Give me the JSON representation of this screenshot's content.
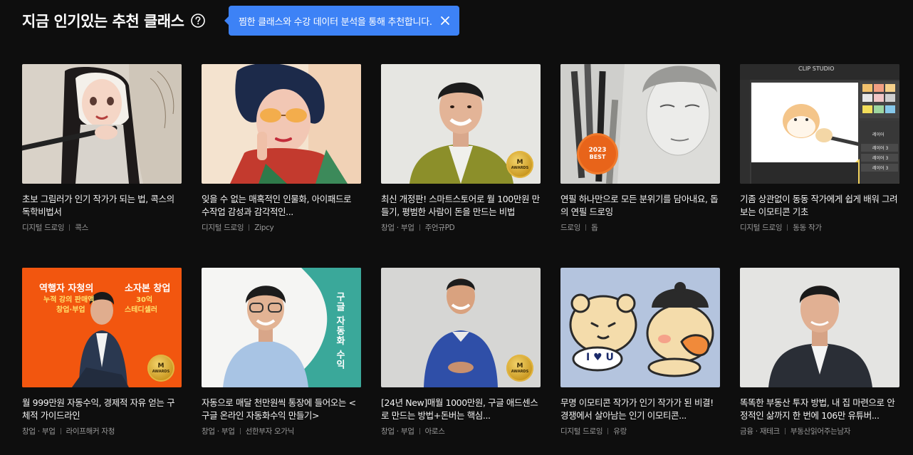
{
  "section": {
    "title": "지금 인기있는 추천 클래스"
  },
  "tooltip": {
    "text": "찜한 클래스와 수강 데이터 분석을 통해 추천합니다."
  },
  "icons": {
    "help": "question-circle-icon",
    "close": "close-icon"
  },
  "colors": {
    "background": "#0e0e0e",
    "tooltip": "#3d82f6",
    "meta": "#9a9a9a"
  },
  "cards": [
    {
      "title": "초보 그림러가 인기 작가가 되는 법, 콕스의 독학비법서",
      "category": "디지털 드로잉",
      "creator": "콕스"
    },
    {
      "title": "잊을 수 없는 매혹적인 인물화, 아이패드로 수작업 감성과 감각적인...",
      "category": "디지털 드로잉",
      "creator": "Zipcy"
    },
    {
      "title": "최신 개정판! 스마트스토어로 월 100만원 만들기, 평범한 사람이 돈을 만드는 비법",
      "category": "창업 · 부업",
      "creator": "주언규PD",
      "badge": "AWARDS"
    },
    {
      "title": "연필 하나만으로 모든 분위기를 담아내요, 돕의 연필 드로잉",
      "category": "드로잉",
      "creator": "돕",
      "badge_year": "2023",
      "badge_text": "BEST"
    },
    {
      "title": "기좀 상관없이 동동 작가에게 쉽게 배워 그려보는 이모티콘 기초",
      "category": "디지털 드로잉",
      "creator": "동동 작가",
      "app_label": "CLIP STUDIO",
      "layer_labels": [
        "레이어",
        "레이어 3",
        "레이어 3",
        "레이어 3"
      ]
    },
    {
      "title": "월 999만원 자동수익, 경제적 자유 얻는 구체적 가이드라인",
      "category": "창업 · 부업",
      "creator": "라이프해커 자청",
      "badge": "AWARDS",
      "overlay": {
        "left_title": "역행자 자청의",
        "right_title": "소자본 창업",
        "line2_left": "누적 강의 판매액",
        "line2_right": "30억",
        "line3_left": "창업·부업",
        "line3_right": "스테디셀러"
      }
    },
    {
      "title": "자동으로 매달 천만원씩 통장에 들어오는 <구글 온라인 자동화수익 만들기>",
      "category": "창업 · 부업",
      "creator": "선한부자 오가닉",
      "vertical_text": "구글 자동화 수익"
    },
    {
      "title": "[24년 New]매월 1000만원, 구글 애드센스로 만드는 방법+돈버는 핵심...",
      "category": "창업 · 부업",
      "creator": "아로스",
      "badge": "AWARDS"
    },
    {
      "title": "무명 이모티콘 작가가 인기 작가가 된 비결! 경쟁에서 살아남는 인기 이모티콘...",
      "category": "디지털 드로잉",
      "creator": "유랑",
      "sticker_text": "I ♥ U"
    },
    {
      "title": "똑똑한 부동산 투자 방법, 내 집 마련으로 안정적인 삶까지 한 번에 106만 유튜버...",
      "category": "금융 · 재테크",
      "creator": "부동산읽어주는남자"
    }
  ]
}
